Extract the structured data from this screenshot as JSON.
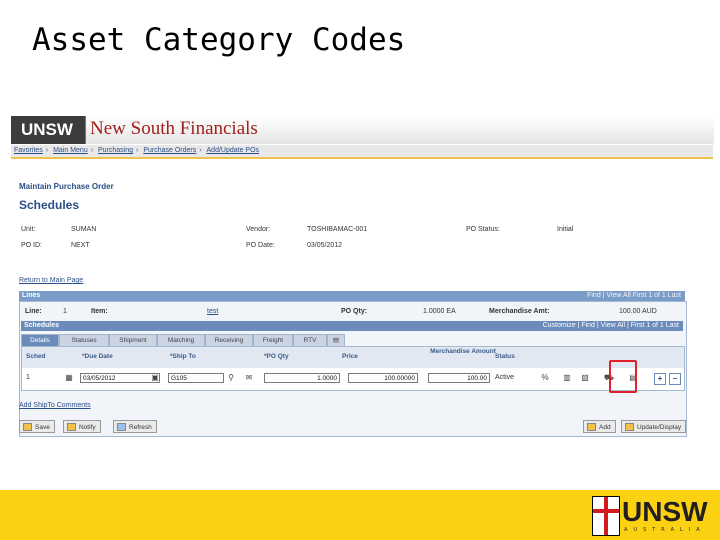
{
  "slide": {
    "title": "Asset Category Codes"
  },
  "banner": {
    "logo": "UNSW",
    "app_name": "New South Financials"
  },
  "breadcrumb": [
    "Favorites",
    "Main Menu",
    "Purchasing",
    "Purchase Orders",
    "Add/Update POs"
  ],
  "page": {
    "heading": "Maintain Purchase Order",
    "subheading": "Schedules",
    "unit_label": "Unit:",
    "unit_value": "SUMAN",
    "poid_label": "PO ID:",
    "poid_value": "NEXT",
    "vendor_label": "Vendor:",
    "vendor_value": "TOSHIBAMAC-001",
    "podate_label": "PO Date:",
    "podate_value": "03/05/2012",
    "status_label": "PO Status:",
    "status_value": "Initial",
    "return_link": "Return to Main Page"
  },
  "lines": {
    "title": "Lines",
    "nav": "Find | View All   First  1 of 1  Last",
    "line_label": "Line:",
    "line_value": "1",
    "item_label": "Item:",
    "item_value": "test",
    "poqty_label": "PO Qty:",
    "poqty_value": "1.0000  EA",
    "merch_label": "Merchandise Amt:",
    "merch_value": "100.00 AUD"
  },
  "schedules": {
    "title": "Schedules",
    "nav": "Customize | Find | View All |     First  1 of 1  Last",
    "tabs": [
      "Details",
      "Statuses",
      "Shipment",
      "Matching",
      "Receiving",
      "Freight",
      "RTV"
    ],
    "columns": [
      "Sched",
      "*Due Date",
      "*Ship To",
      "*PO Qty",
      "Price",
      "Merchandise Amount",
      "Status"
    ],
    "row": {
      "sched": "1",
      "due_date": "03/05/2012",
      "ship_to": "G105",
      "po_qty": "1.0000",
      "price": "100.00000",
      "merch_amount": "100.00",
      "status": "Active"
    }
  },
  "add_shipto_link": "Add ShipTo Comments",
  "buttons": {
    "save": "Save",
    "notify": "Notify",
    "refresh": "Refresh",
    "add": "Add",
    "update_display": "Update/Display"
  },
  "footer": {
    "logo": "UNSW",
    "sub": "AUSTRALIA"
  }
}
